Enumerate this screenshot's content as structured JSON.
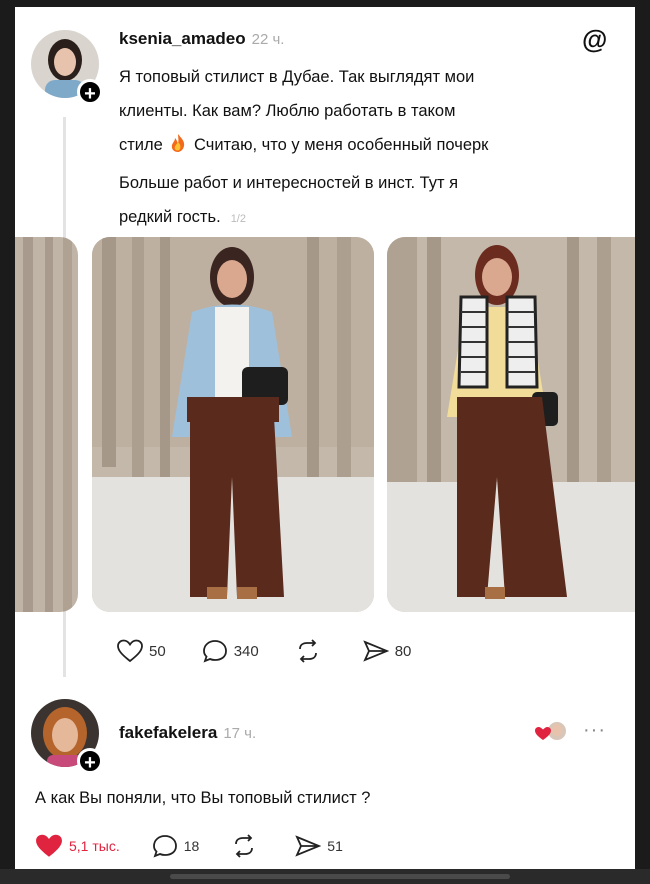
{
  "post": {
    "username": "ksenia_amadeo",
    "time": "22 ч.",
    "line1": "Я топовый стилист в Дубае. Так выглядят мои",
    "line2": "клиенты. Как вам? Люблю работать в таком",
    "line3a": "стиле",
    "line3b": "Считаю, что у меня особенный почерк",
    "line4": "Больше работ и интересностей в инст. Тут я",
    "line5": "редкий гость.",
    "counter": "1/2",
    "likes": "50",
    "comments": "340",
    "shares": "80"
  },
  "reply": {
    "username": "fakefakelera",
    "time": "17 ч.",
    "text": "А как Вы поняли, что Вы топовый стилист ?",
    "likes": "5,1 тыс.",
    "comments": "18",
    "shares": "51",
    "more": "···"
  },
  "colors": {
    "like_red": "#e0233f",
    "brown_pants": "#5a2a1c",
    "curtain": "#b9ada0"
  },
  "icons": [
    "threads-logo-icon",
    "heart-icon",
    "comment-icon",
    "repost-icon",
    "share-icon",
    "fire-emoji-icon",
    "plus-icon",
    "more-icon"
  ]
}
